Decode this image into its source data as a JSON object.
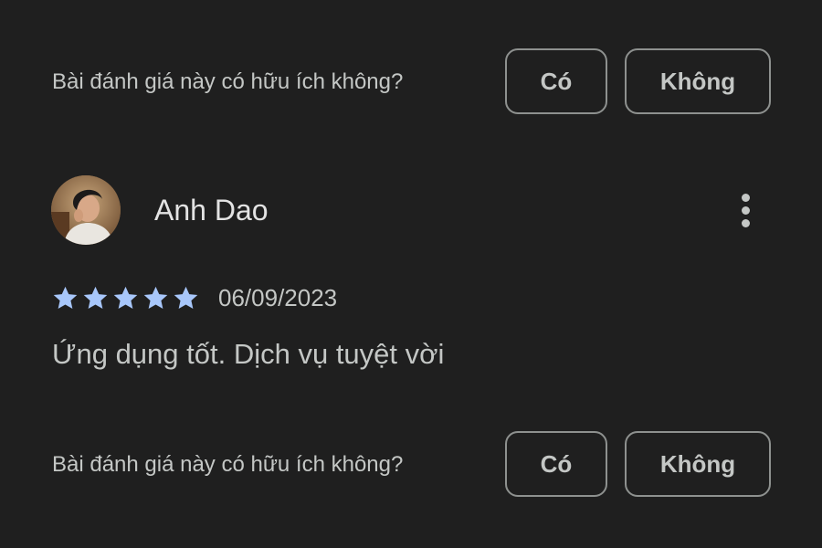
{
  "helpful_prompt_top": {
    "question": "Bài đánh giá này có hữu ích không?",
    "yes_label": "Có",
    "no_label": "Không"
  },
  "review": {
    "reviewer_name": "Anh Dao",
    "rating": 5,
    "rating_max": 5,
    "date": "06/09/2023",
    "text": "Ứng dụng tốt. Dịch vụ tuyệt vời",
    "star_color": "#a8c7fa",
    "more_icon": "more-vert-icon"
  },
  "helpful_prompt_bottom": {
    "question": "Bài đánh giá này có hữu ích không?",
    "yes_label": "Có",
    "no_label": "Không"
  },
  "colors": {
    "background": "#1f1f1f",
    "text_primary": "#e3e3e3",
    "text_secondary": "#c4c7c5",
    "button_border": "#8e918f"
  }
}
